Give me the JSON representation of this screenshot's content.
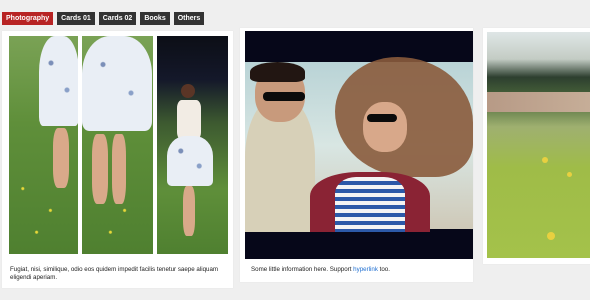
{
  "filters": [
    {
      "label": "Photography",
      "active": true
    },
    {
      "label": "Cards 01",
      "active": false
    },
    {
      "label": "Cards 02",
      "active": false
    },
    {
      "label": "Books",
      "active": false
    },
    {
      "label": "Others",
      "active": false
    }
  ],
  "cards": [
    {
      "caption": "Fugiat, nisi, similique, odio eos quidem impedit facilis tenetur saepe aliquam eligendi aperiam."
    },
    {
      "caption_before": "Some little information here. Support ",
      "caption_link": "hyperlink",
      "caption_after": " too."
    },
    {
      "caption": ""
    }
  ],
  "colors": {
    "active_tab": "#b82424",
    "tab": "#333333",
    "link": "#1f6fd1"
  }
}
